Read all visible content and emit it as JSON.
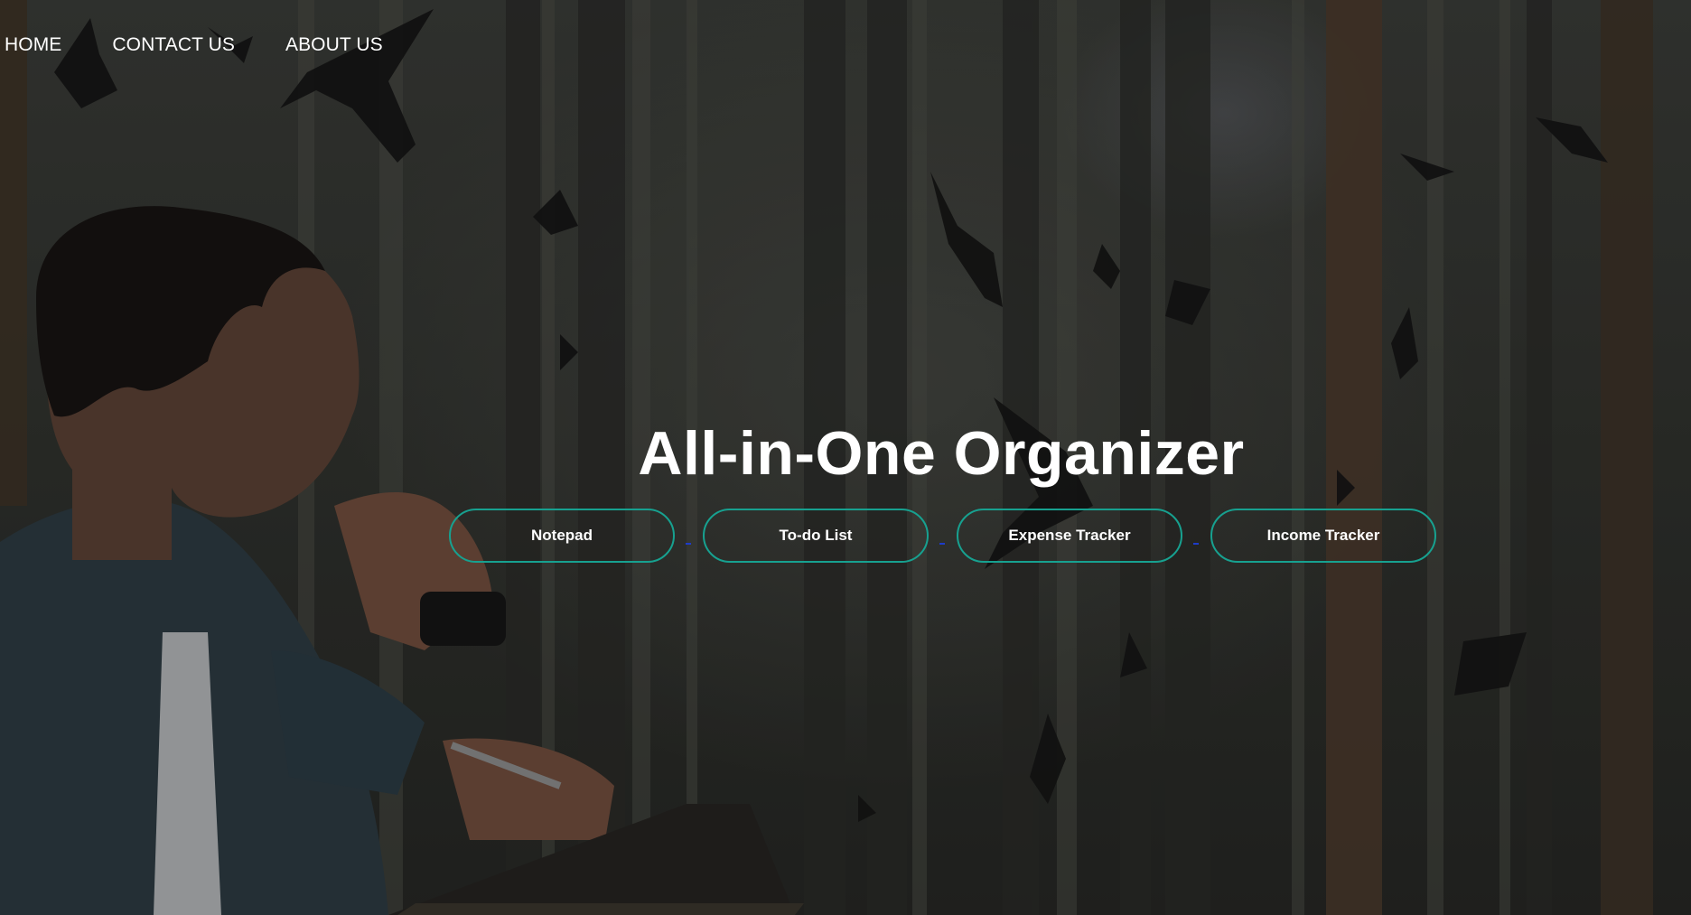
{
  "nav": {
    "home_label": "HOME",
    "contact_label": "CONTACT US",
    "about_label": "ABOUT US"
  },
  "hero": {
    "title": "All-in-One Organizer",
    "buttons": [
      {
        "label": "Notepad"
      },
      {
        "label": "To-do List"
      },
      {
        "label": "Expense Tracker"
      },
      {
        "label": "Income Tracker"
      }
    ]
  },
  "colors": {
    "button_border": "#17a190",
    "text": "#ffffff",
    "separator": "#1d3cc9",
    "background": "#30322e"
  },
  "icons": [
    "bird-silhouette-icon",
    "person-thinking-illustration",
    "notebook-icon",
    "pen-icon"
  ]
}
